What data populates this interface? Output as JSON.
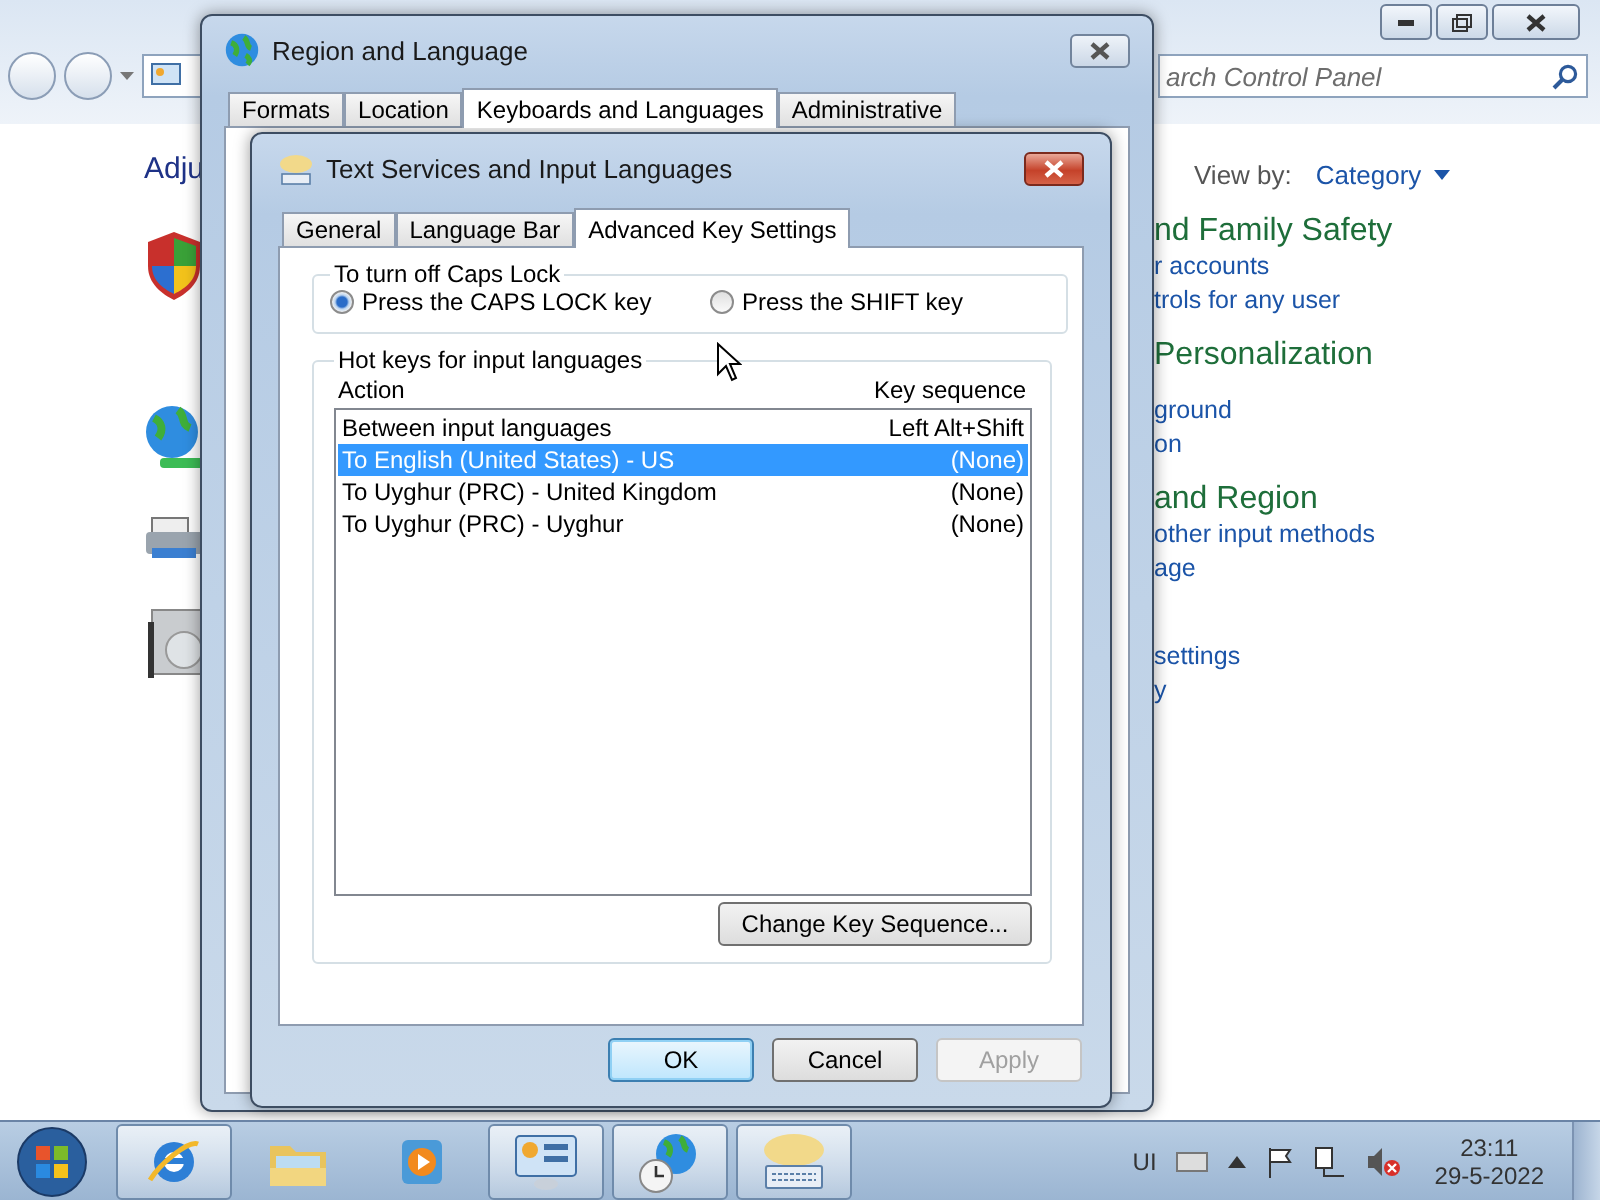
{
  "control_panel": {
    "search": {
      "placeholder": "arch Control Panel"
    },
    "heading": "Adju",
    "view_by": {
      "label": "View by:",
      "value": "Category"
    },
    "categories": [
      {
        "title": "nd Family Safety",
        "links": [
          "r accounts",
          "trols for any user"
        ]
      },
      {
        "title": "Personalization",
        "links": [
          "ground",
          "on"
        ]
      },
      {
        "title": "and Region",
        "links": [
          "other input methods",
          "age"
        ]
      },
      {
        "links": [
          "settings",
          "y"
        ]
      }
    ]
  },
  "region_dialog": {
    "title": "Region and Language",
    "tabs": [
      {
        "label": "Formats",
        "selected": false
      },
      {
        "label": "Location",
        "selected": false
      },
      {
        "label": "Keyboards and Languages",
        "selected": true
      },
      {
        "label": "Administrative",
        "selected": false
      }
    ]
  },
  "text_services": {
    "title": "Text Services and Input Languages",
    "tabs": [
      {
        "label": "General",
        "selected": false
      },
      {
        "label": "Language Bar",
        "selected": false
      },
      {
        "label": "Advanced Key Settings",
        "selected": true
      }
    ],
    "caps_lock": {
      "title": "To turn off Caps Lock",
      "options": [
        {
          "label": "Press the CAPS LOCK key",
          "selected": true
        },
        {
          "label": "Press the SHIFT key",
          "selected": false
        }
      ]
    },
    "hotkeys": {
      "title": "Hot keys for input languages",
      "columns": [
        "Action",
        "Key sequence"
      ],
      "rows": [
        {
          "action": "Between input languages",
          "key": "Left Alt+Shift",
          "selected": false
        },
        {
          "action": "To English (United States) - US",
          "key": "(None)",
          "selected": true
        },
        {
          "action": "To Uyghur (PRC) - United Kingdom",
          "key": "(None)",
          "selected": false
        },
        {
          "action": "To Uyghur (PRC) - Uyghur",
          "key": "(None)",
          "selected": false
        }
      ],
      "change_button": "Change Key Sequence..."
    },
    "buttons": [
      {
        "label": "OK",
        "kind": "default",
        "disabled": false
      },
      {
        "label": "Cancel",
        "kind": "normal",
        "disabled": false
      },
      {
        "label": "Apply",
        "kind": "normal",
        "disabled": true
      }
    ]
  },
  "taskbar": {
    "apps": [
      {
        "active": true
      },
      {
        "active": false
      },
      {
        "active": false
      },
      {
        "active": true
      },
      {
        "active": true
      },
      {
        "active": true
      }
    ],
    "tray": {
      "language": "UI",
      "time": "23:11",
      "date": "29-5-2022"
    }
  }
}
